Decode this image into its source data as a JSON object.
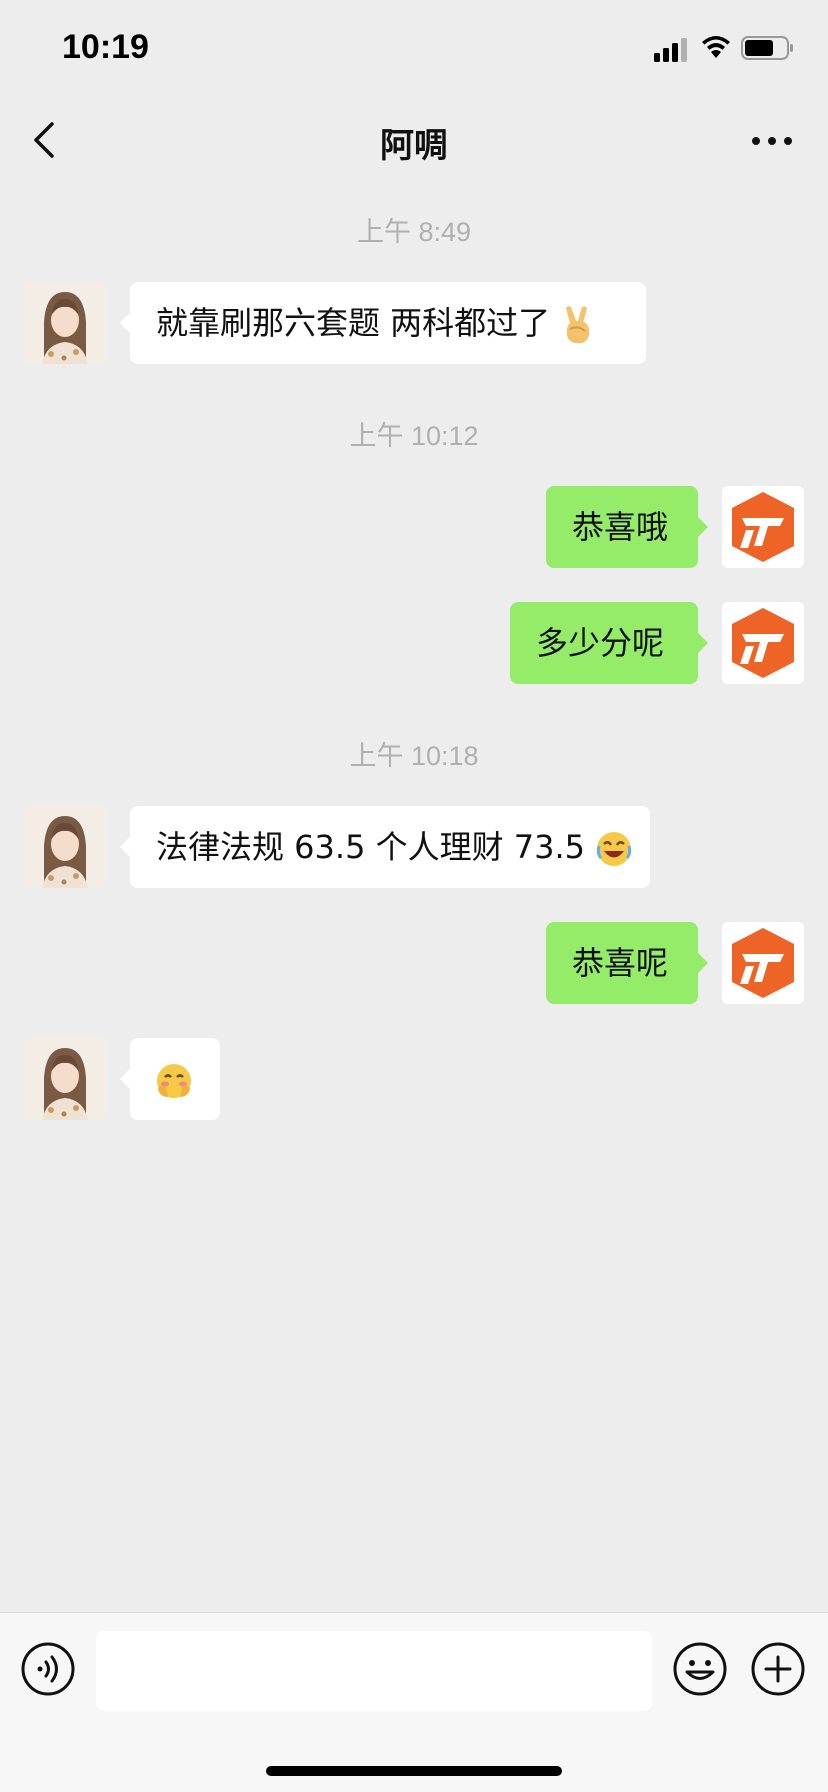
{
  "status_bar": {
    "time": "10:19"
  },
  "header": {
    "title": "阿啁"
  },
  "timestamps": [
    "上午 8:49",
    "上午 10:12",
    "上午 10:18"
  ],
  "messages": [
    {
      "sender": "contact",
      "text": "就靠刷那六套题 两科都过了",
      "emoji": "victory-hand-icon"
    },
    {
      "sender": "me",
      "text": "恭喜哦"
    },
    {
      "sender": "me",
      "text": "多少分呢"
    },
    {
      "sender": "contact",
      "text": "法律法规 63.5 个人理财 73.5",
      "emoji": "rolling-laughing-icon"
    },
    {
      "sender": "me",
      "text": "恭喜呢"
    },
    {
      "sender": "contact",
      "text": "",
      "emoji": "shy-face-icon"
    }
  ],
  "input": {
    "placeholder": ""
  },
  "colors": {
    "background": "#ededed",
    "outgoing_bubble": "#95ec69",
    "incoming_bubble": "#ffffff",
    "my_avatar": "#ee6427"
  }
}
